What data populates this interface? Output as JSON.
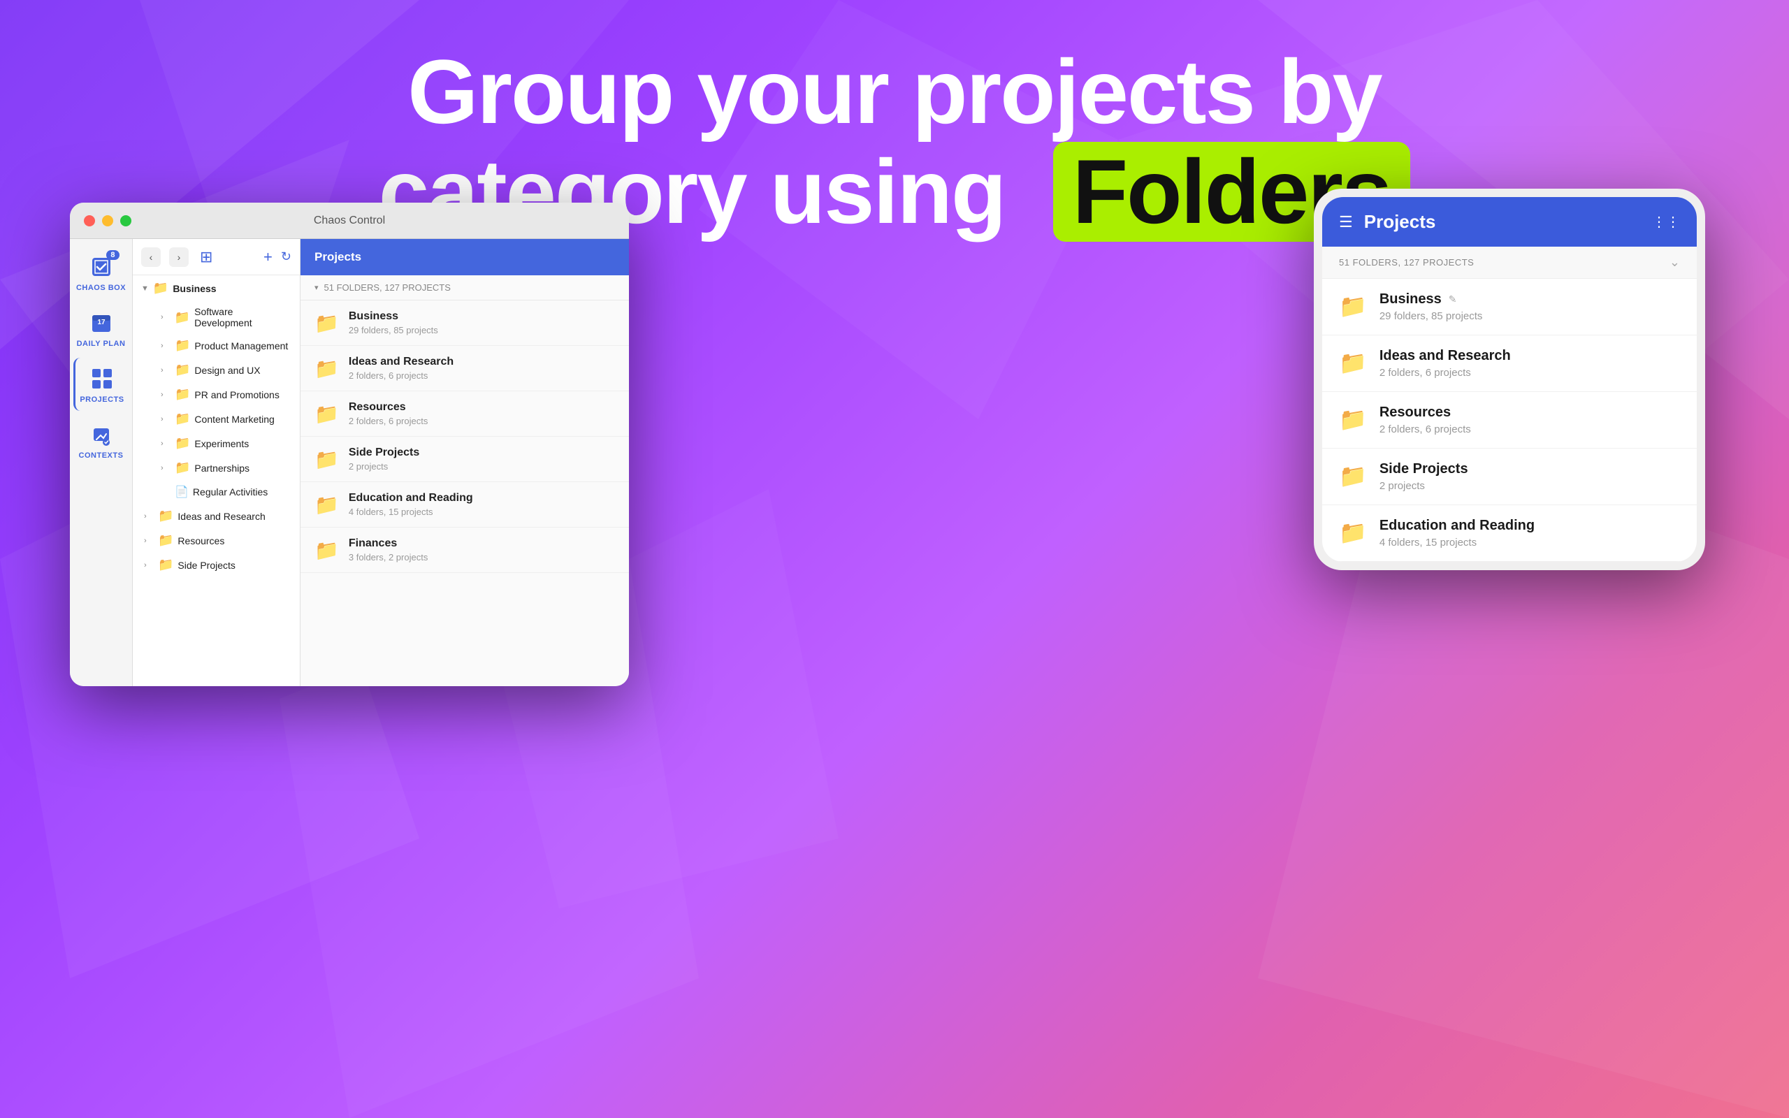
{
  "hero": {
    "line1": "Group your projects by",
    "line2_prefix": "category using",
    "line2_highlight": "Folders"
  },
  "mac_window": {
    "title": "Chaos Control",
    "toolbar": {
      "add": "+",
      "refresh": "↻"
    },
    "icon_rail": [
      {
        "id": "chaos-box",
        "label": "CHAOS BOX",
        "badge": "8",
        "active": false
      },
      {
        "id": "daily-plan",
        "label": "DAILY PLAN",
        "badge": null,
        "active": false
      },
      {
        "id": "projects",
        "label": "PROJECTS",
        "badge": null,
        "active": true
      },
      {
        "id": "contexts",
        "label": "CONTEXTS",
        "badge": null,
        "active": false
      }
    ],
    "tree": {
      "groups": [
        {
          "name": "Business",
          "expanded": true,
          "children": [
            {
              "name": "Software Development",
              "type": "folder"
            },
            {
              "name": "Product Management",
              "type": "folder"
            },
            {
              "name": "Design and UX",
              "type": "folder"
            },
            {
              "name": "PR and Promotions",
              "type": "folder"
            },
            {
              "name": "Content Marketing",
              "type": "folder"
            },
            {
              "name": "Experiments",
              "type": "folder"
            },
            {
              "name": "Partnerships",
              "type": "folder"
            },
            {
              "name": "Regular Activities",
              "type": "doc"
            }
          ]
        },
        {
          "name": "Ideas and Research",
          "expanded": false,
          "children": []
        },
        {
          "name": "Resources",
          "expanded": false,
          "children": []
        },
        {
          "name": "Side Projects",
          "expanded": false,
          "children": []
        }
      ]
    },
    "main": {
      "header": "Projects",
      "count_label": "51 FOLDERS, 127 PROJECTS",
      "folders": [
        {
          "name": "Business",
          "meta": "29 folders, 85 projects"
        },
        {
          "name": "Ideas and Research",
          "meta": "2 folders, 6 projects"
        },
        {
          "name": "Resources",
          "meta": "2 folders, 6 projects"
        },
        {
          "name": "Side Projects",
          "meta": "2 projects"
        },
        {
          "name": "Education and Reading",
          "meta": "4 folders, 15 projects"
        },
        {
          "name": "Finances",
          "meta": "3 folders, 2 projects"
        }
      ]
    }
  },
  "mobile_window": {
    "header": "Projects",
    "count_label": "51 FOLDERS, 127 PROJECTS",
    "folders": [
      {
        "name": "Business",
        "meta": "29 folders, 85 projects",
        "edit": true
      },
      {
        "name": "Ideas and Research",
        "meta": "2 folders, 6 projects",
        "edit": false
      },
      {
        "name": "Resources",
        "meta": "2 folders, 6 projects",
        "edit": false
      },
      {
        "name": "Side Projects",
        "meta": "2 projects",
        "edit": false
      },
      {
        "name": "Education and Reading",
        "meta": "4 folders, 15 projects",
        "edit": false
      }
    ]
  }
}
